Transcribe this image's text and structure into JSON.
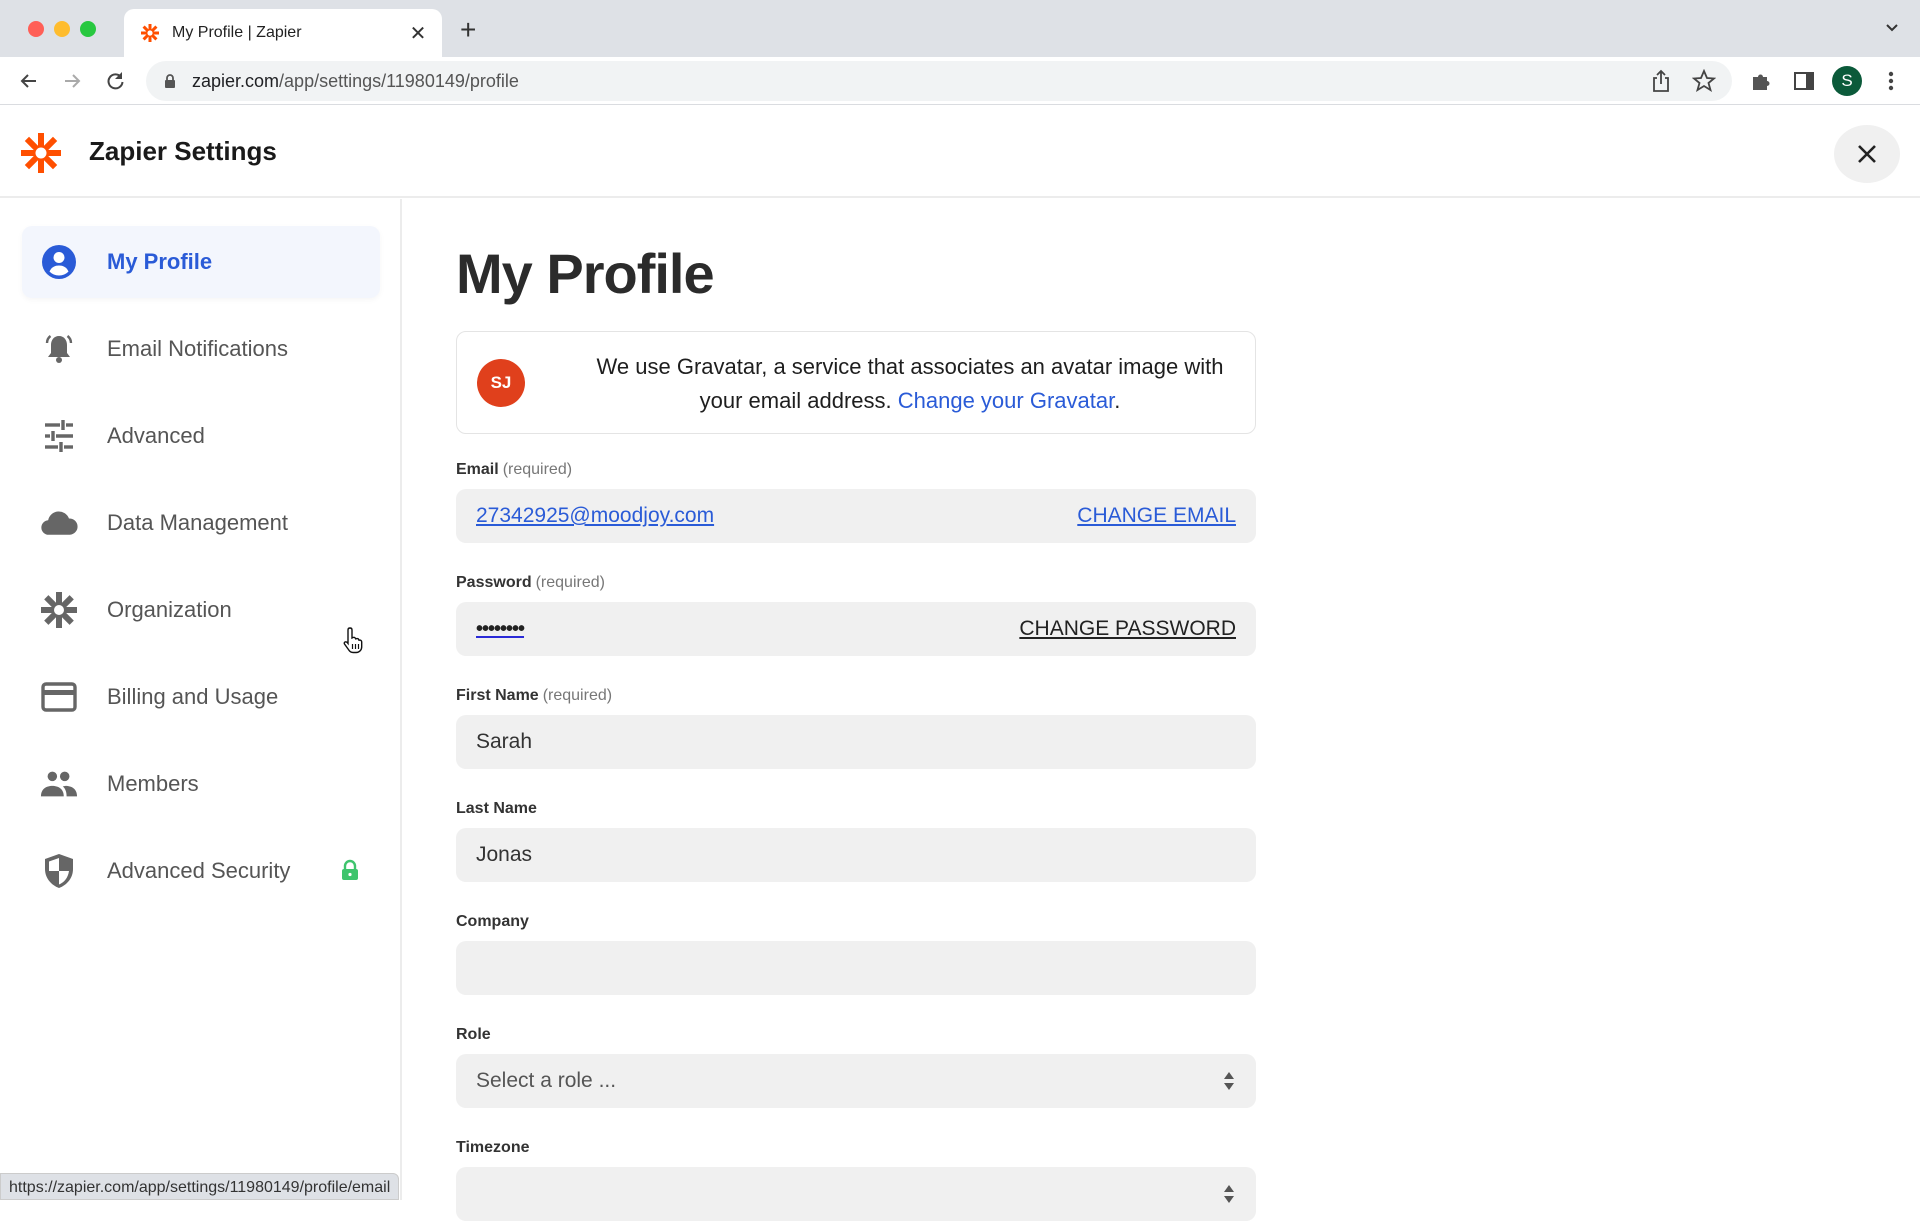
{
  "browser": {
    "tab_title": "My Profile | Zapier",
    "url_host": "zapier.com",
    "url_path": "/app/settings/11980149/profile",
    "profile_initial": "S",
    "status_url": "https://zapier.com/app/settings/11980149/profile/email"
  },
  "header": {
    "title": "Zapier Settings"
  },
  "sidebar": {
    "items": [
      {
        "label": "My Profile",
        "icon": "user-circle-icon",
        "active": true
      },
      {
        "label": "Email Notifications",
        "icon": "bell-icon"
      },
      {
        "label": "Advanced",
        "icon": "sliders-icon"
      },
      {
        "label": "Data Management",
        "icon": "cloud-icon"
      },
      {
        "label": "Organization",
        "icon": "asterisk-icon"
      },
      {
        "label": "Billing and Usage",
        "icon": "credit-card-icon"
      },
      {
        "label": "Members",
        "icon": "people-icon"
      },
      {
        "label": "Advanced Security",
        "icon": "shield-icon",
        "badge": "lock-icon"
      }
    ]
  },
  "main": {
    "title": "My Profile",
    "gravatar": {
      "initials": "SJ",
      "text": "We use Gravatar, a service that associates an avatar image with your email address.",
      "link": "Change your Gravatar",
      "suffix": "."
    },
    "required_tag": "(required)",
    "email": {
      "label": "Email",
      "value": "27342925@moodjoy.com",
      "action": "CHANGE EMAIL"
    },
    "password": {
      "label": "Password",
      "value": "••••••••",
      "action": "CHANGE PASSWORD"
    },
    "first_name": {
      "label": "First Name",
      "value": "Sarah"
    },
    "last_name": {
      "label": "Last Name",
      "value": "Jonas"
    },
    "company": {
      "label": "Company",
      "value": ""
    },
    "role": {
      "label": "Role",
      "placeholder": "Select a role ..."
    },
    "timezone": {
      "label": "Timezone",
      "value": ""
    }
  },
  "colors": {
    "brand_orange": "#ff4f00",
    "accent_blue": "#2a5bd7",
    "lock_green": "#3ec46d"
  }
}
